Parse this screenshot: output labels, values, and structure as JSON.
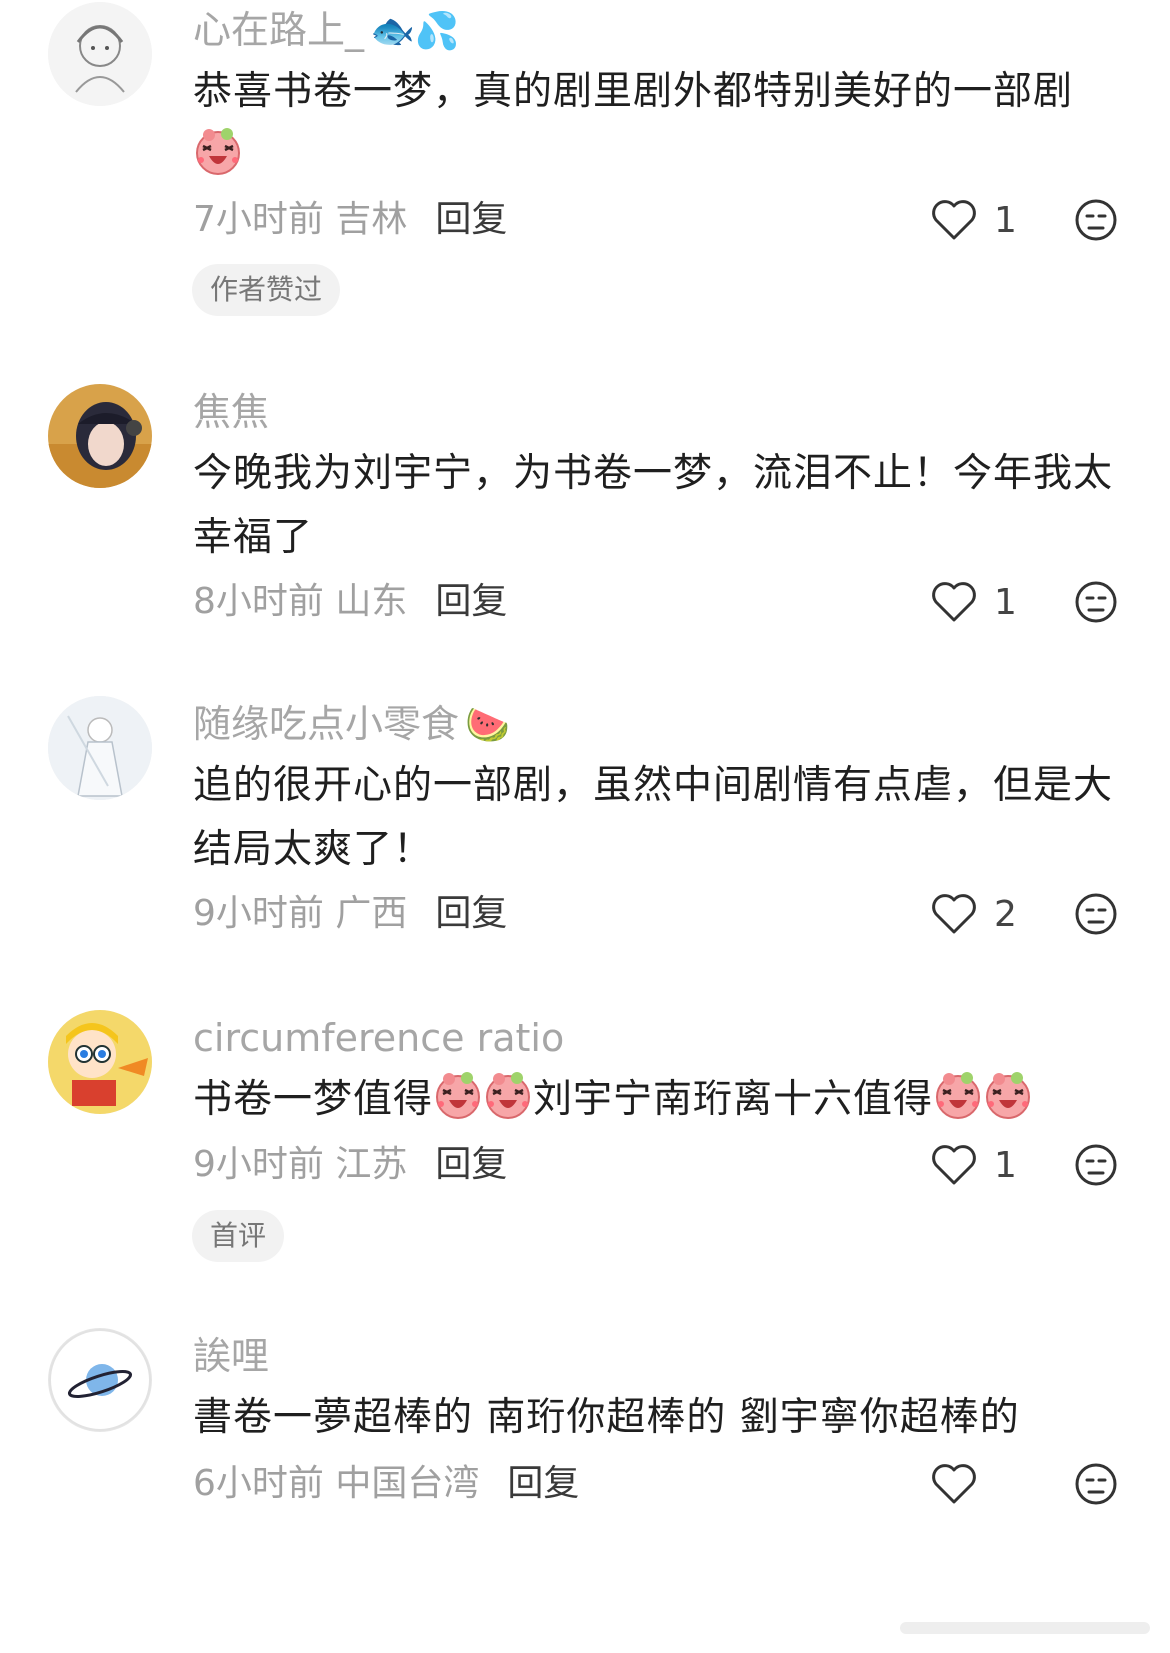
{
  "comments": [
    {
      "username": "心在路上_",
      "username_emoji": "🐟💦",
      "text_parts": [
        "恭喜书卷一梦，真的剧里剧外都特别美好的一部剧"
      ],
      "time_location": "7小时前 吉林",
      "reply": "回复",
      "likes": "1",
      "tag": "作者赞过"
    },
    {
      "username": "焦焦",
      "text_parts": [
        "今晚我为刘宇宁，为书卷一梦，流泪不止！今年我太幸福了"
      ],
      "time_location": "8小时前 山东",
      "reply": "回复",
      "likes": "1"
    },
    {
      "username": "随缘吃点小零食",
      "username_emoji": "🍉",
      "text_parts": [
        "追的很开心的一部剧，虽然中间剧情有点虐，但是大结局太爽了！"
      ],
      "time_location": "9小时前 广西",
      "reply": "回复",
      "likes": "2"
    },
    {
      "username": "circumference ratio",
      "text_parts": [
        "书卷一梦值得",
        "刘宇宁南珩离十六值得"
      ],
      "time_location": "9小时前 江苏",
      "reply": "回复",
      "likes": "1",
      "tag": "首评"
    },
    {
      "username": "誒哩",
      "text_parts": [
        "書卷一夢超棒的 南珩你超棒的 劉宇寧你超棒的"
      ],
      "time_location": "6小时前 中国台湾",
      "reply": "回复",
      "likes": ""
    }
  ],
  "icons": {
    "like": "heart-outline-icon",
    "dislike": "neutral-face-icon",
    "sticker": "laughing-pig-sticker"
  },
  "colors": {
    "username": "#a6a6a6",
    "text": "#1f1f1f",
    "meta": "#a0a0a0",
    "tag_bg": "#f2f2f2"
  }
}
